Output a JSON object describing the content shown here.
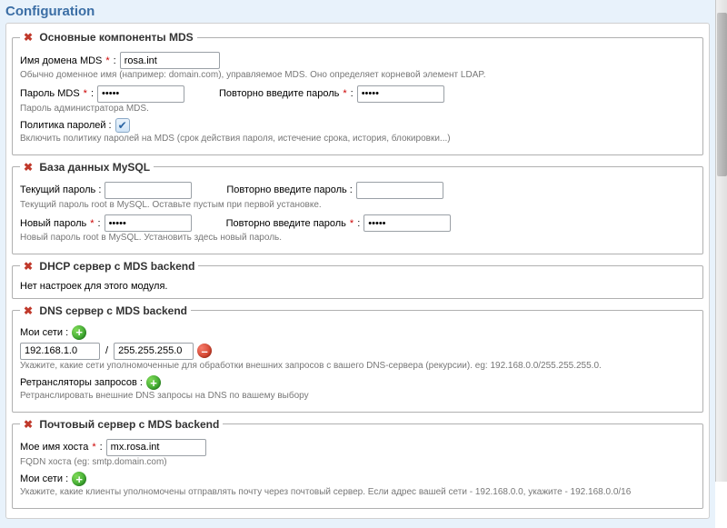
{
  "page_title": "Configuration",
  "sections": {
    "mds": {
      "legend": "Основные компоненты MDS",
      "domain_label": "Имя домена MDS",
      "domain_value": "rosa.int",
      "domain_hint": "Обычно доменное имя (например: domain.com), управляемое MDS. Оно определяет корневой элемент LDAP.",
      "password_label": "Пароль MDS",
      "password_value": "•••••",
      "password2_label": "Повторно введите пароль",
      "password2_value": "•••••",
      "password_hint": "Пароль администратора MDS.",
      "policy_label": "Политика паролей :",
      "policy_checked": true,
      "policy_hint": "Включить политику паролей на MDS (срок действия пароля, истечение срока, история, блокировки...)"
    },
    "mysql": {
      "legend": "База данных MySQL",
      "current_label": "Текущий пароль :",
      "current2_label": "Повторно введите пароль :",
      "current_hint": "Текущий пароль root в MySQL. Оставьте пустым при первой установке.",
      "new_label": "Новый пароль",
      "new_value": "•••••",
      "new2_label": "Повторно введите пароль",
      "new2_value": "•••••",
      "new_hint": "Новый пароль root в MySQL. Установить здесь новый пароль."
    },
    "dhcp": {
      "legend": "DHCP сервер с MDS backend",
      "empty": "Нет настроек для этого модуля."
    },
    "dns": {
      "legend": "DNS сервер с MDS backend",
      "nets_label": "Мои сети :",
      "net_value": "192.168.1.0",
      "mask_value": "255.255.255.0",
      "nets_hint": "Укажите, какие сети уполномоченные для обработки внешних запросов с вашего DNS-сервера (рекурсии). eg: 192.168.0.0/255.255.255.0.",
      "forwarders_label": "Ретрансляторы запросов :",
      "forwarders_hint": "Ретранслировать внешние DNS запросы на DNS по вашему выбору"
    },
    "mail": {
      "legend": "Почтовый сервер с MDS backend",
      "host_label": "Мое имя хоста",
      "host_value": "mx.rosa.int",
      "host_hint": "FQDN хоста (eg: smtp.domain.com)",
      "nets_label": "Мои сети :",
      "nets_hint": "Укажите, какие клиенты уполномочены отправлять почту через почтовый сервер. Если адрес вашей сети - 192.168.0.0, укажите - 192.168.0.0/16"
    }
  },
  "glyphs": {
    "colon": " :",
    "star": " *",
    "slash": "/"
  }
}
